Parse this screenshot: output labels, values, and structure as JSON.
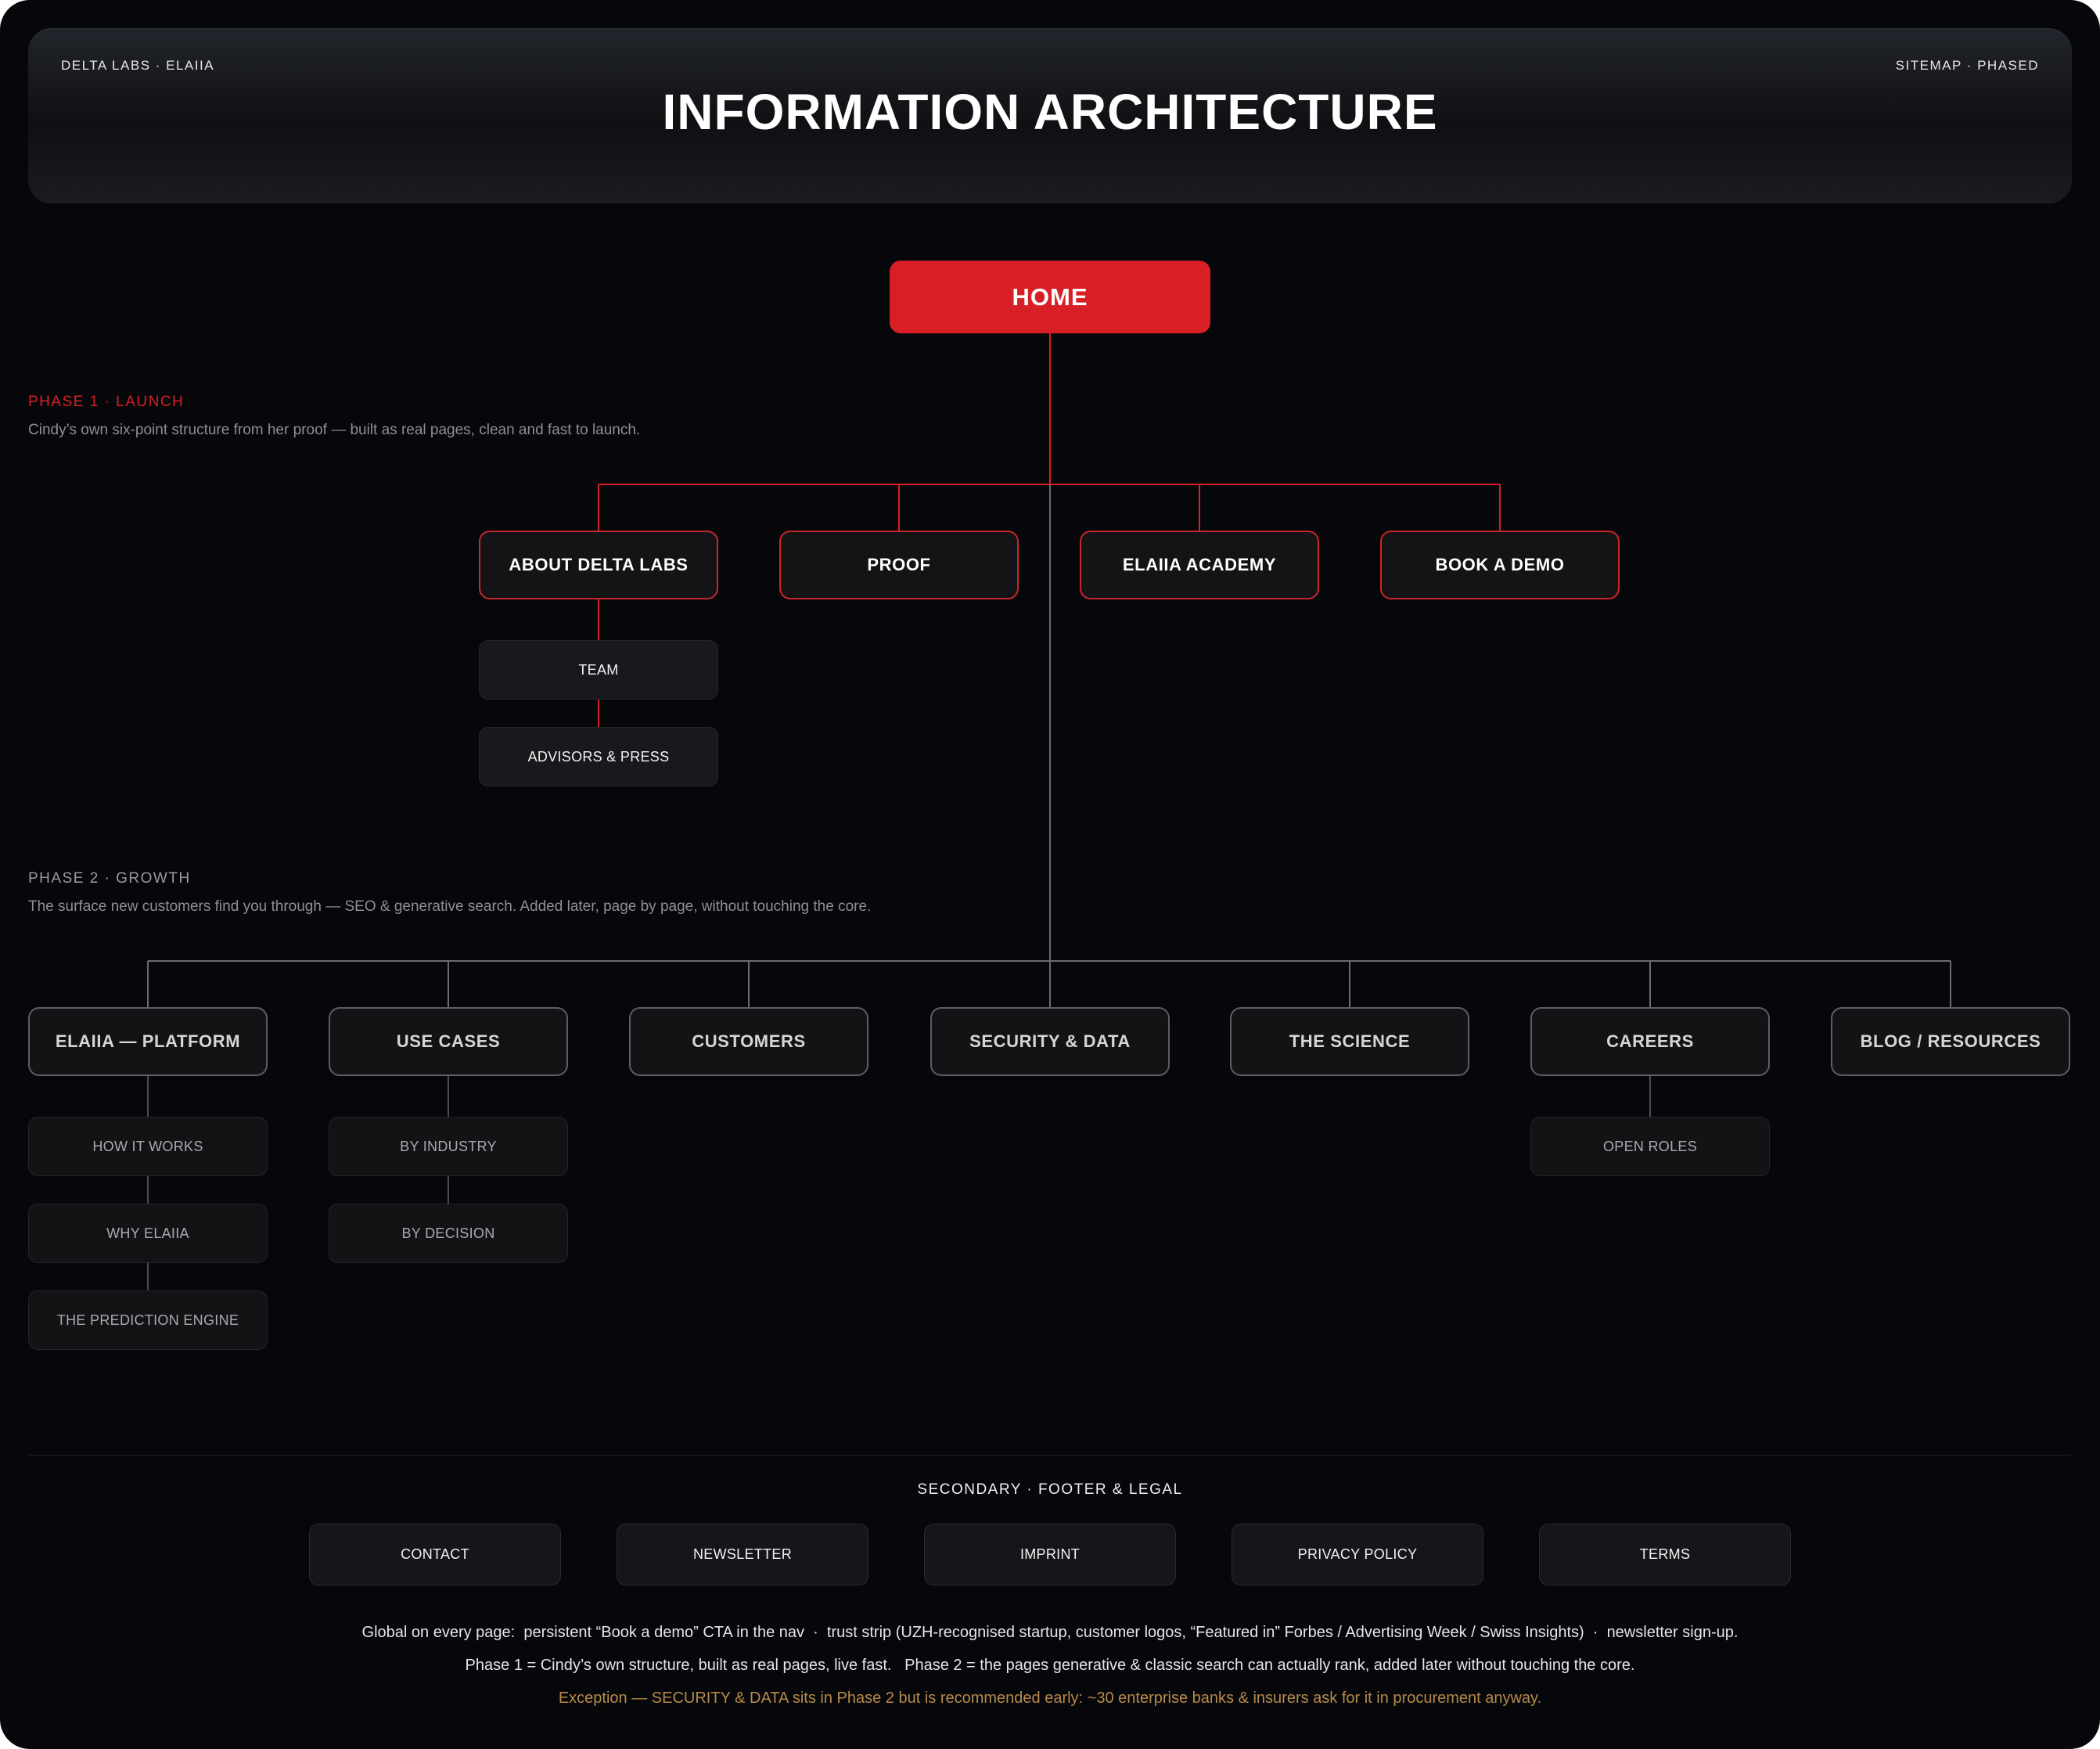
{
  "header": {
    "left_label": "DELTA LABS · ELAIIA",
    "right_label": "SITEMAP · PHASED",
    "title": "INFORMATION ARCHITECTURE"
  },
  "colors": {
    "background": "#06070a",
    "phase1_accent": "#d81f26",
    "phase2_line": "#5c5e63",
    "exception_text": "#b88a4a"
  },
  "home": {
    "label": "HOME"
  },
  "phase1": {
    "label": "PHASE 1 · LAUNCH",
    "description": "Cindy’s own six-point structure from her proof — built as real pages, clean and fast to launch.",
    "pages": [
      {
        "label": "ABOUT DELTA LABS",
        "children": [
          "TEAM",
          "ADVISORS & PRESS"
        ]
      },
      {
        "label": "PROOF",
        "children": []
      },
      {
        "label": "ELAIIA ACADEMY",
        "children": []
      },
      {
        "label": "BOOK A DEMO",
        "children": []
      }
    ]
  },
  "phase2": {
    "label": "PHASE 2 · GROWTH",
    "description": "The surface new customers find you through — SEO & generative search. Added later, page by page, without touching the core.",
    "pages": [
      {
        "label": "ELAIIA — PLATFORM",
        "children": [
          "HOW IT WORKS",
          "WHY ELAIIA",
          "THE PREDICTION ENGINE"
        ]
      },
      {
        "label": "USE CASES",
        "children": [
          "BY INDUSTRY",
          "BY DECISION"
        ]
      },
      {
        "label": "CUSTOMERS",
        "children": []
      },
      {
        "label": "SECURITY & DATA",
        "children": []
      },
      {
        "label": "THE SCIENCE",
        "children": []
      },
      {
        "label": "CAREERS",
        "children": [
          "OPEN ROLES"
        ]
      },
      {
        "label": "BLOG / RESOURCES",
        "children": []
      }
    ]
  },
  "secondary": {
    "label": "SECONDARY · FOOTER & LEGAL",
    "pages": [
      "CONTACT",
      "NEWSLETTER",
      "IMPRINT",
      "PRIVACY POLICY",
      "TERMS"
    ]
  },
  "notes": {
    "global": "Global on every page:  persistent “Book a demo” CTA in the nav  ·  trust strip (UZH-recognised startup, customer logos, “Featured in” Forbes / Advertising Week / Swiss Insights)  ·  newsletter sign-up.",
    "phases": "Phase 1 = Cindy’s own structure, built as real pages, live fast.   Phase 2 = the pages generative & classic search can actually rank, added later without touching the core.",
    "exception": "Exception — SECURITY & DATA sits in Phase 2 but is recommended early: ~30 enterprise banks & insurers ask for it in procurement anyway."
  }
}
